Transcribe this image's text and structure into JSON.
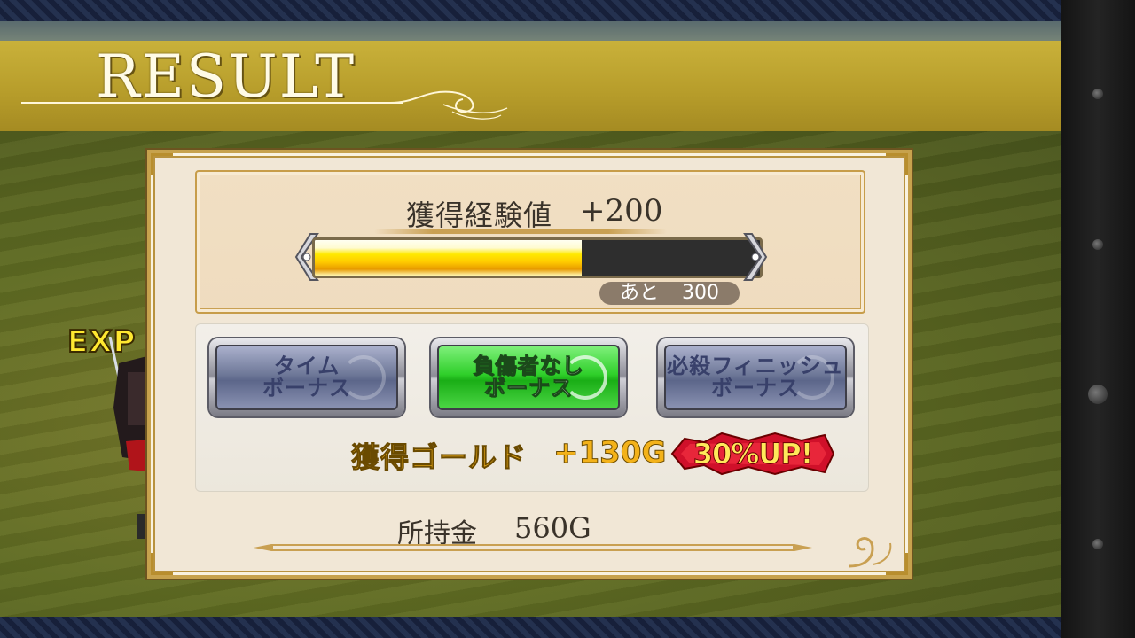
{
  "header": {
    "title": "RESULT"
  },
  "battle": {
    "exp_tag": "EXP"
  },
  "experience": {
    "label": "獲得経験値",
    "gain": "+200",
    "remaining_label": "あと",
    "remaining_value": "300",
    "progress_fraction": 0.6
  },
  "bonuses": [
    {
      "line1": "タイム",
      "line2": "ボーナス",
      "active": false
    },
    {
      "line1": "負傷者なし",
      "line2": "ボーナス",
      "active": true
    },
    {
      "line1": "必殺フィニッシュ",
      "line2": "ボーナス",
      "active": false
    }
  ],
  "gold": {
    "label": "獲得ゴールド",
    "gain": "+130G",
    "badge": "30%UP!"
  },
  "money": {
    "label": "所持金",
    "value": "560G"
  },
  "colors": {
    "gold_text": "#f3b21a",
    "badge_red": "#d0102a",
    "active_green": "#2fcf2a",
    "band": "#c9b13a"
  }
}
